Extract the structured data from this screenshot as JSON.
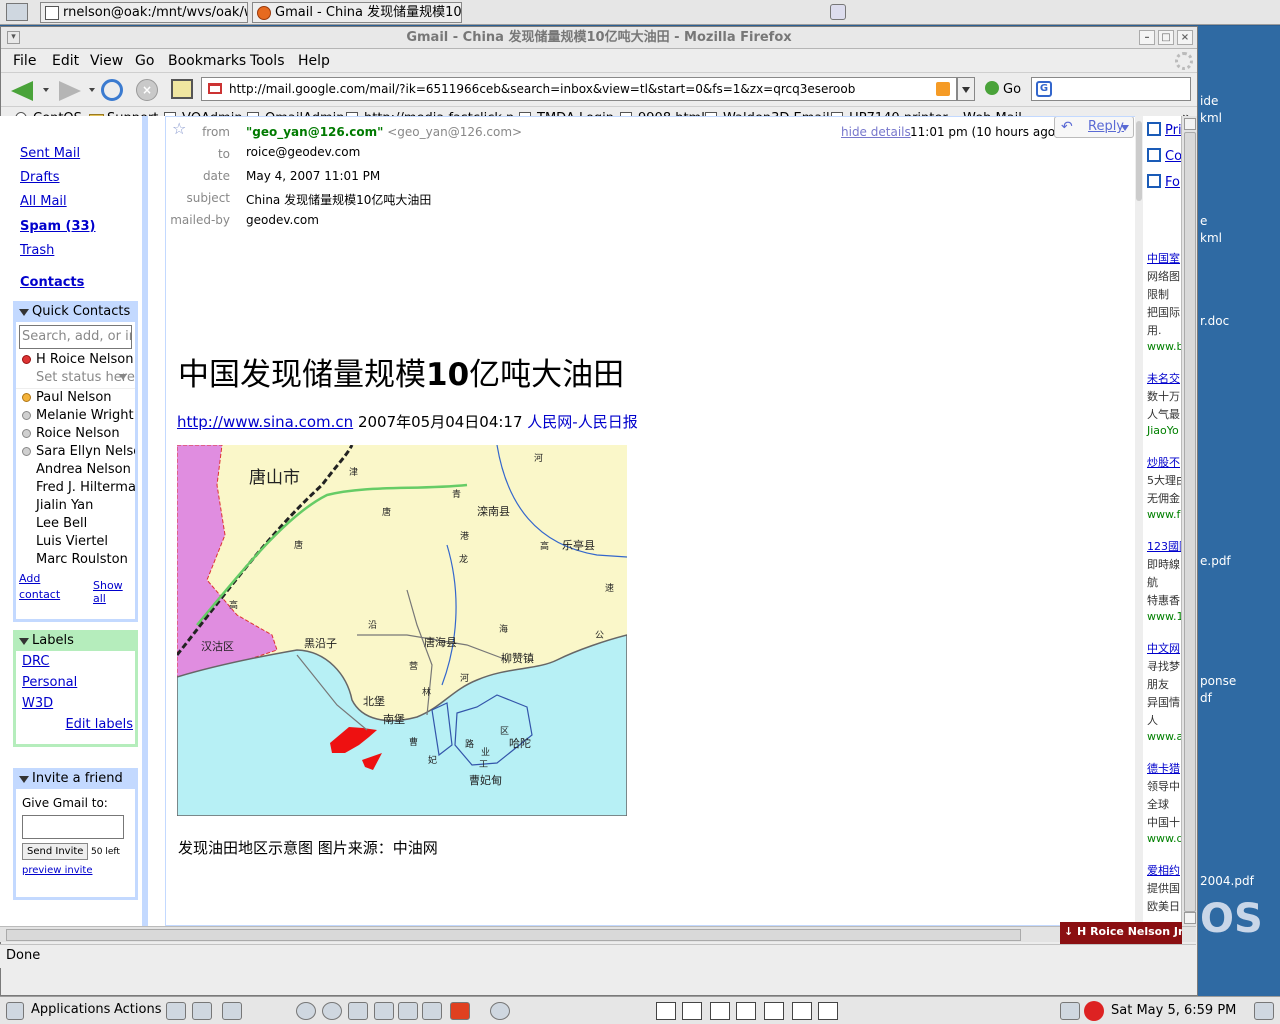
{
  "taskbar": {
    "tasks": [
      {
        "label": "rnelson@oak:/mnt/wvs/oak/ww"
      },
      {
        "label": "Gmail - China 发现储量规模10亿"
      }
    ]
  },
  "window": {
    "title": "Gmail - China 发现储量规模10亿吨大油田 - Mozilla Firefox"
  },
  "menu": {
    "items": [
      "File",
      "Edit",
      "View",
      "Go",
      "Bookmarks",
      "Tools",
      "Help"
    ]
  },
  "navigation": {
    "url": "http://mail.google.com/mail/?ik=6511966ceb&search=inbox&view=tl&start=0&fs=1&zx=qrcq3eseroob",
    "go_label": "Go",
    "search_value": ""
  },
  "bookmarks": {
    "items": [
      "CentOS",
      "Support",
      "VQAdmin",
      "QmailAdmin",
      "http://media.fastclick.n...",
      "TMDA Login",
      "9908.html",
      "Walden3D Email",
      "HP7140 printer",
      "Web Mail"
    ],
    "overflow": "»"
  },
  "gmail": {
    "nav": {
      "sent_mail": "Sent Mail",
      "drafts": "Drafts",
      "all_mail": "All Mail",
      "spam": "Spam (33)",
      "trash": "Trash",
      "contacts": "Contacts"
    },
    "quick_contacts": {
      "title": "Quick Contacts",
      "search_placeholder": "Search, add, or invite",
      "me": "H Roice Nelson Jr",
      "set_status": "Set status here",
      "contacts": [
        {
          "name": "Paul Nelson",
          "status": "orange"
        },
        {
          "name": "Melanie Wright",
          "status": "grey"
        },
        {
          "name": "Roice Nelson",
          "status": "grey"
        },
        {
          "name": "Sara Ellyn Nelson",
          "status": "grey"
        },
        {
          "name": "Andrea Nelson",
          "status": "none"
        },
        {
          "name": "Fred J. Hilterman",
          "status": "none"
        },
        {
          "name": "Jialin Yan",
          "status": "none"
        },
        {
          "name": "Lee Bell",
          "status": "none"
        },
        {
          "name": "Luis Viertel",
          "status": "none"
        },
        {
          "name": "Marc Roulston",
          "status": "none"
        }
      ],
      "add_contact_1": "Add",
      "add_contact_2": "contact",
      "show_all": "Show all"
    },
    "labels": {
      "title": "Labels",
      "items": [
        "DRC",
        "Personal",
        "W3D"
      ],
      "edit": "Edit labels"
    },
    "invite": {
      "title": "Invite a friend",
      "prompt": "Give Gmail to:",
      "button": "Send Invite",
      "left": "50 left",
      "preview": "preview invite"
    },
    "message": {
      "from_label": "from",
      "from_name": "\"geo_yan@126.com\"",
      "from_addr": "<geo_yan@126.com>",
      "to_label": "to",
      "to": "roice@geodev.com",
      "date_label": "date",
      "date": "May 4, 2007 11:01 PM",
      "subject_label": "subject",
      "subject": "China 发现储量规模10亿吨大油田",
      "mailedby_label": "mailed-by",
      "mailedby": "geodev.com",
      "hide_details": "hide details",
      "time": "11:01 pm (10 hours ago)",
      "reply": "Reply",
      "body_title_a": "中国发现储量规模",
      "body_title_b": "10",
      "body_title_c": "亿吨大油田",
      "src_link": "http://www.sina.com.cn",
      "src_date": "2007年05月04日04:17",
      "src_outlet": "人民网-人民日报",
      "caption": "发现油田地区示意图 图片来源：中油网"
    },
    "map": {
      "labels": [
        "唐山市",
        "津",
        "唐",
        "唐",
        "青",
        "滦南县",
        "港",
        "龙",
        "高",
        "乐亭县",
        "河",
        "速",
        "高",
        "汉沽区",
        "黑沿子",
        "沿",
        "唐海县",
        "海",
        "公",
        "柳赞镇",
        "营",
        "河",
        "北堡",
        "南堡",
        "林",
        "曹",
        "妃",
        "路",
        "业",
        "工",
        "区",
        "哈陀",
        "曹妃甸"
      ]
    },
    "right_panel": {
      "actions": [
        "Pri",
        "Co",
        "Fo"
      ],
      "ads": [
        {
          "title": "中国室",
          "lines": [
            "网络图",
            "限制",
            "把国际",
            "用."
          ],
          "url": "www.b"
        },
        {
          "title": "未名交",
          "lines": [
            "数十万",
            "人气最"
          ],
          "url": "JiaoYo"
        },
        {
          "title": "炒股不",
          "lines": [
            "5大理由",
            "无佣金"
          ],
          "url": "www.fo"
        },
        {
          "title": "123國際",
          "lines": [
            "即時線",
            "航",
            "特惠香"
          ],
          "url": "www.1"
        },
        {
          "title": "中文网",
          "lines": [
            "寻找梦",
            "朋友",
            "异国情",
            "人"
          ],
          "url": "www.a"
        },
        {
          "title": "德卡猎",
          "lines": [
            "领导中",
            "全球",
            "中国十"
          ],
          "url": "www.dk"
        },
        {
          "title": "爱相约",
          "lines": [
            "提供国",
            "欧美日"
          ],
          "url": ""
        }
      ]
    },
    "chat_tab": "H Roice Nelson Jr"
  },
  "status": {
    "text": "Done"
  },
  "desktop": {
    "items": [
      "ide",
      "kml",
      "e",
      "kml",
      "r.doc",
      "e.pdf",
      "ponse",
      "df",
      "2004.pdf",
      "OS"
    ]
  },
  "panel": {
    "applications": "Applications",
    "actions": "Actions",
    "clock": "Sat May  5,  6:59 PM"
  },
  "colors": {
    "gmail_blue": "#c3d9ff",
    "gmail_green": "#b5edbc",
    "link": "#0000cc",
    "sea": "#b7f0f5",
    "land": "#faf7c9",
    "land_left": "#e08de0",
    "oilfield": "#ee1111"
  }
}
